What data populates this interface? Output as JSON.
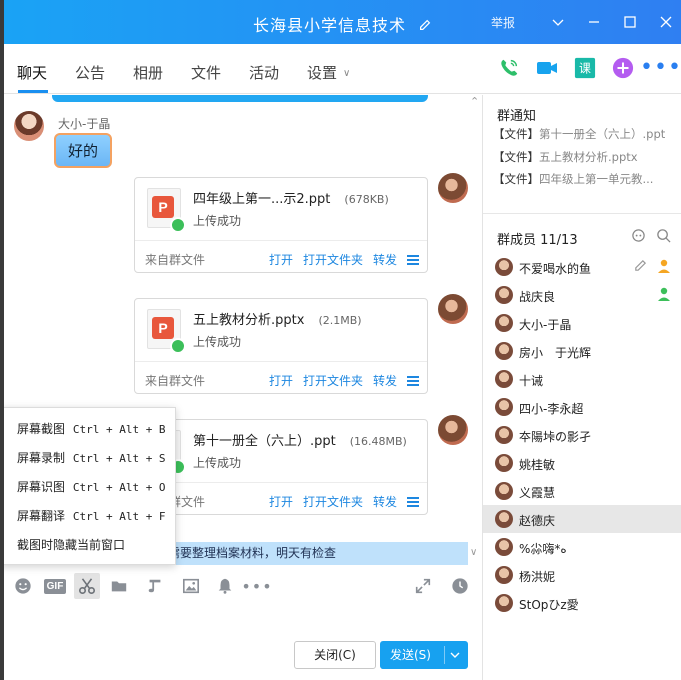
{
  "window": {
    "title": "长海县小学信息技术",
    "report": "举报"
  },
  "tabs": [
    {
      "label": "聊天"
    },
    {
      "label": "公告"
    },
    {
      "label": "相册"
    },
    {
      "label": "文件"
    },
    {
      "label": "活动"
    },
    {
      "label": "设置"
    }
  ],
  "chat": {
    "message": {
      "sender": "大小-于晶",
      "text": "好的"
    },
    "files": [
      {
        "name": "四年级上第一...示2.ppt",
        "size": "(678KB)",
        "status": "上传成功",
        "from": "来自群文件"
      },
      {
        "name": "五上教材分析.pptx",
        "size": "(2.1MB)",
        "status": "上传成功",
        "from": "来自群文件"
      },
      {
        "name": "第十一册全（六上）.ppt",
        "size": "(16.48MB)",
        "status": "上传成功",
        "from": "来自群文件"
      }
    ],
    "file_actions": {
      "open": "打开",
      "open_folder": "打开文件夹",
      "forward": "转发"
    },
    "notice": "需要整理档案材料，明天有检查"
  },
  "screenshot_menu": [
    {
      "label": "屏幕截图",
      "key": "Ctrl + Alt + B"
    },
    {
      "label": "屏幕录制",
      "key": "Ctrl + Alt + S"
    },
    {
      "label": "屏幕识图",
      "key": "Ctrl + Alt + O"
    },
    {
      "label": "屏幕翻译",
      "key": "Ctrl + Alt + F"
    },
    {
      "label": "截图时隐藏当前窗口",
      "key": ""
    }
  ],
  "toolbar": {
    "gif_label": "GIF"
  },
  "buttons": {
    "close": "关闭(C)",
    "send": "发送(S)"
  },
  "side": {
    "notice_title": "群通知",
    "notices": [
      {
        "tag": "【文件】",
        "text": "第十一册全（六上）.ppt"
      },
      {
        "tag": "【文件】",
        "text": "五上教材分析.pptx"
      },
      {
        "tag": "【文件】",
        "text": "四年级上第一单元教..."
      }
    ],
    "members_title": "群成员 11/13",
    "members": [
      {
        "name": "不爱喝水的鱼"
      },
      {
        "name": "战庆良"
      },
      {
        "name": "大小-于晶"
      },
      {
        "name": "房小　于光辉"
      },
      {
        "name": "十诫"
      },
      {
        "name": "四小-李永超"
      },
      {
        "name": "夲陽垰の影孑"
      },
      {
        "name": "姚桂敏"
      },
      {
        "name": "义霞慧"
      },
      {
        "name": "赵德庆"
      },
      {
        "name": "%尛嗨*ه"
      },
      {
        "name": "杨洪妮"
      },
      {
        "name": "ЅtОpひz愛"
      }
    ]
  },
  "colors": {
    "accent": "#1a8ff0",
    "title_bar": "#1aa3f5",
    "notice_bg": "#bfe1fb"
  }
}
